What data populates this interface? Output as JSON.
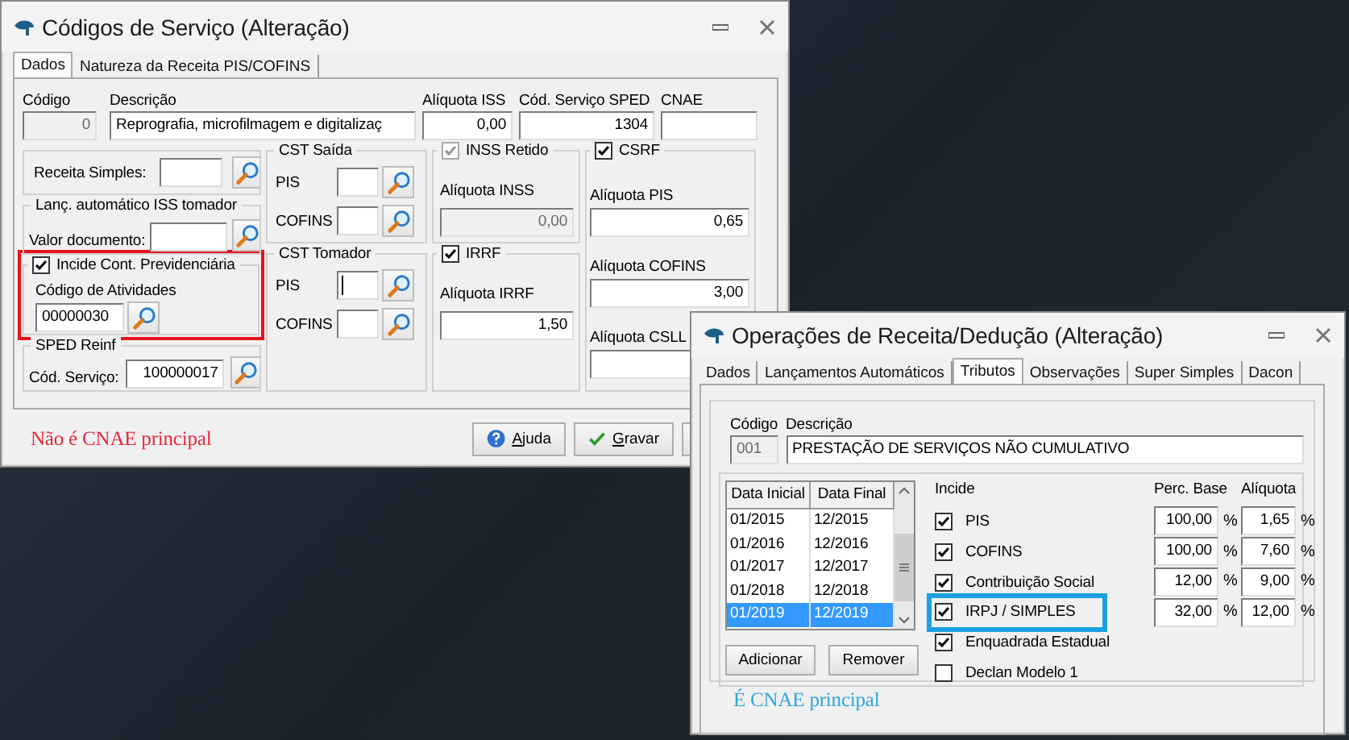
{
  "service_window": {
    "title": "Códigos de Serviço (Alteração)",
    "tabs": [
      {
        "label": "Dados",
        "selected": true
      },
      {
        "label": "Natureza da Receita PIS/COFINS",
        "selected": false
      }
    ],
    "header_fields": [
      {
        "label": "Código",
        "value": "0",
        "kind": "number",
        "disabled": true
      },
      {
        "label": "Descrição",
        "value": "Reprografia, microfilmagem e digitalizaç",
        "kind": "text",
        "disabled": false
      },
      {
        "label": "Alíquota ISS",
        "value": "0,00",
        "kind": "number",
        "disabled": false
      },
      {
        "label": "Cód. Serviço SPED",
        "value": "1304",
        "kind": "number",
        "disabled": false
      },
      {
        "label": "CNAE",
        "kind": "text",
        "disabled": false
      }
    ],
    "receita_simples": {
      "label": "Receita Simples:"
    },
    "iss_tomador": {
      "title": "Lanç. automático ISS tomador",
      "label": "Valor documento:"
    },
    "previdenciaria": {
      "label": "Incide Cont. Previdenciária",
      "checked": true,
      "highlighted": true,
      "field_label": "Código de Atividades",
      "value": "00000030"
    },
    "sped_reinf": {
      "title": "SPED Reinf",
      "label": "Cód. Serviço:",
      "value": "100000017"
    },
    "cst_saida": {
      "title": "CST Saída",
      "rows": [
        {
          "label": "PIS",
          "focused": false
        },
        {
          "label": "COFINS",
          "focused": false
        }
      ]
    },
    "cst_tomador": {
      "title": "CST Tomador",
      "rows": [
        {
          "label": "PIS",
          "focused": true
        },
        {
          "label": "COFINS",
          "focused": false
        }
      ]
    },
    "inss": {
      "label": "INSS Retido",
      "checked": true,
      "disabled": true,
      "field_label": "Alíquota INSS",
      "value": "0,00"
    },
    "irrf": {
      "label": "IRRF",
      "checked": true,
      "disabled": false,
      "field_label": "Alíquota IRRF",
      "value": "1,50"
    },
    "csrf": {
      "label": "CSRF",
      "checked": true,
      "fields": [
        {
          "label": "Alíquota PIS",
          "value": "0,65"
        },
        {
          "label": "Alíquota COFINS",
          "value": "3,00"
        },
        {
          "label": "Alíquota CSLL"
        }
      ]
    },
    "message": "Não é CNAE principal",
    "buttons": [
      {
        "kind": "help",
        "label": "Ajuda"
      },
      {
        "kind": "save",
        "label": "Gravar"
      },
      {
        "kind": "cancel"
      }
    ]
  },
  "operation_window": {
    "title": "Operações de Receita/Dedução (Alteração)",
    "tabs": [
      {
        "label": "Dados",
        "selected": false
      },
      {
        "label": "Lançamentos Automáticos",
        "selected": false
      },
      {
        "label": "Tributos",
        "selected": true
      },
      {
        "label": "Observações",
        "selected": false
      },
      {
        "label": "Super Simples",
        "selected": false
      },
      {
        "label": "Dacon",
        "selected": false
      }
    ],
    "codigo": {
      "label": "Código",
      "value": "001",
      "disabled": true
    },
    "descricao": {
      "label": "Descrição",
      "value": "PRESTAÇÃO DE SERVIÇOS NÃO CUMULATIVO"
    },
    "periods": {
      "columns": [
        "Data Inicial",
        "Data Final"
      ],
      "rows": [
        {
          "start": "01/2015",
          "end": "12/2015",
          "selected": false
        },
        {
          "start": "01/2016",
          "end": "12/2016",
          "selected": false
        },
        {
          "start": "01/2017",
          "end": "12/2017",
          "selected": false
        },
        {
          "start": "01/2018",
          "end": "12/2018",
          "selected": false
        },
        {
          "start": "01/2019",
          "end": "12/2019",
          "selected": true
        }
      ]
    },
    "add_button": "Adicionar",
    "remove_button": "Remover",
    "incide": {
      "header": "Incide",
      "base_header": "Perc. Base",
      "rate_header": "Alíquota",
      "rows": [
        {
          "label": "PIS",
          "checked": true,
          "highlighted": false,
          "base": "100,00",
          "base_unit": "%",
          "rate": "1,65",
          "rate_unit": "%"
        },
        {
          "label": "COFINS",
          "checked": true,
          "highlighted": false,
          "base": "100,00",
          "base_unit": "%",
          "rate": "7,60",
          "rate_unit": "%"
        },
        {
          "label": "Contribuição Social",
          "checked": true,
          "highlighted": false,
          "base": "12,00",
          "base_unit": "%",
          "rate": "9,00",
          "rate_unit": "%"
        },
        {
          "label": "IRPJ / SIMPLES",
          "checked": true,
          "highlighted": true,
          "base": "32,00",
          "base_unit": "%",
          "rate": "12,00",
          "rate_unit": "%"
        },
        {
          "label": "Enquadrada Estadual",
          "checked": true,
          "highlighted": false
        },
        {
          "label": "Declan Modelo 1",
          "checked": false,
          "highlighted": false
        }
      ]
    },
    "message": "É CNAE principal"
  }
}
